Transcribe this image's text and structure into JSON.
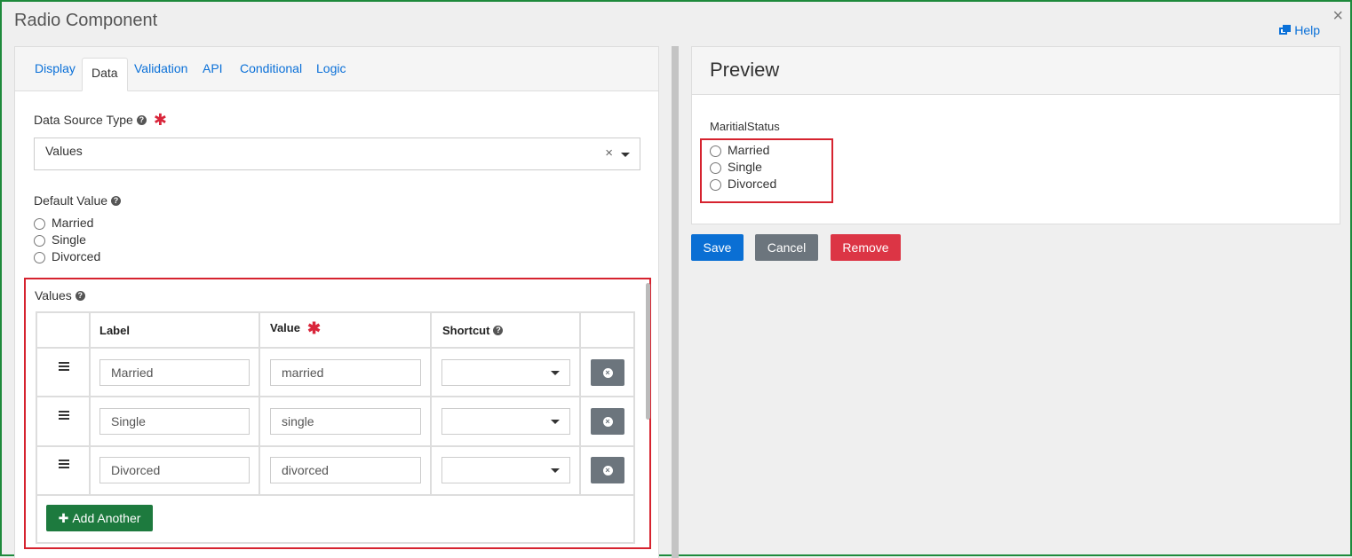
{
  "dialog": {
    "title": "Radio Component",
    "help_label": "Help",
    "close_glyph": "×"
  },
  "tabs": [
    {
      "label": "Display",
      "active": false
    },
    {
      "label": "Data",
      "active": true
    },
    {
      "label": "Validation",
      "active": false
    },
    {
      "label": "API",
      "active": false
    },
    {
      "label": "Conditional",
      "active": false
    },
    {
      "label": "Logic",
      "active": false
    }
  ],
  "data_source": {
    "label": "Data Source Type",
    "required": true,
    "value": "Values",
    "clear_glyph": "×"
  },
  "default_value": {
    "label": "Default Value",
    "options": [
      "Married",
      "Single",
      "Divorced"
    ]
  },
  "values_table": {
    "label": "Values",
    "headers": {
      "label": "Label",
      "value": "Value",
      "shortcut": "Shortcut"
    },
    "rows": [
      {
        "label": "Married",
        "value": "married",
        "shortcut": ""
      },
      {
        "label": "Single",
        "value": "single",
        "shortcut": ""
      },
      {
        "label": "Divorced",
        "value": "divorced",
        "shortcut": ""
      }
    ],
    "add_label": "Add Another",
    "add_glyph": "✚"
  },
  "preview": {
    "title": "Preview",
    "field_label": "MaritialStatus",
    "options": [
      "Married",
      "Single",
      "Divorced"
    ]
  },
  "actions": {
    "save": "Save",
    "cancel": "Cancel",
    "remove": "Remove"
  },
  "colors": {
    "primary": "#0a6fd4",
    "secondary": "#6c757d",
    "danger": "#dc3545",
    "success": "#1d7a3e",
    "highlight": "#d6232f"
  }
}
